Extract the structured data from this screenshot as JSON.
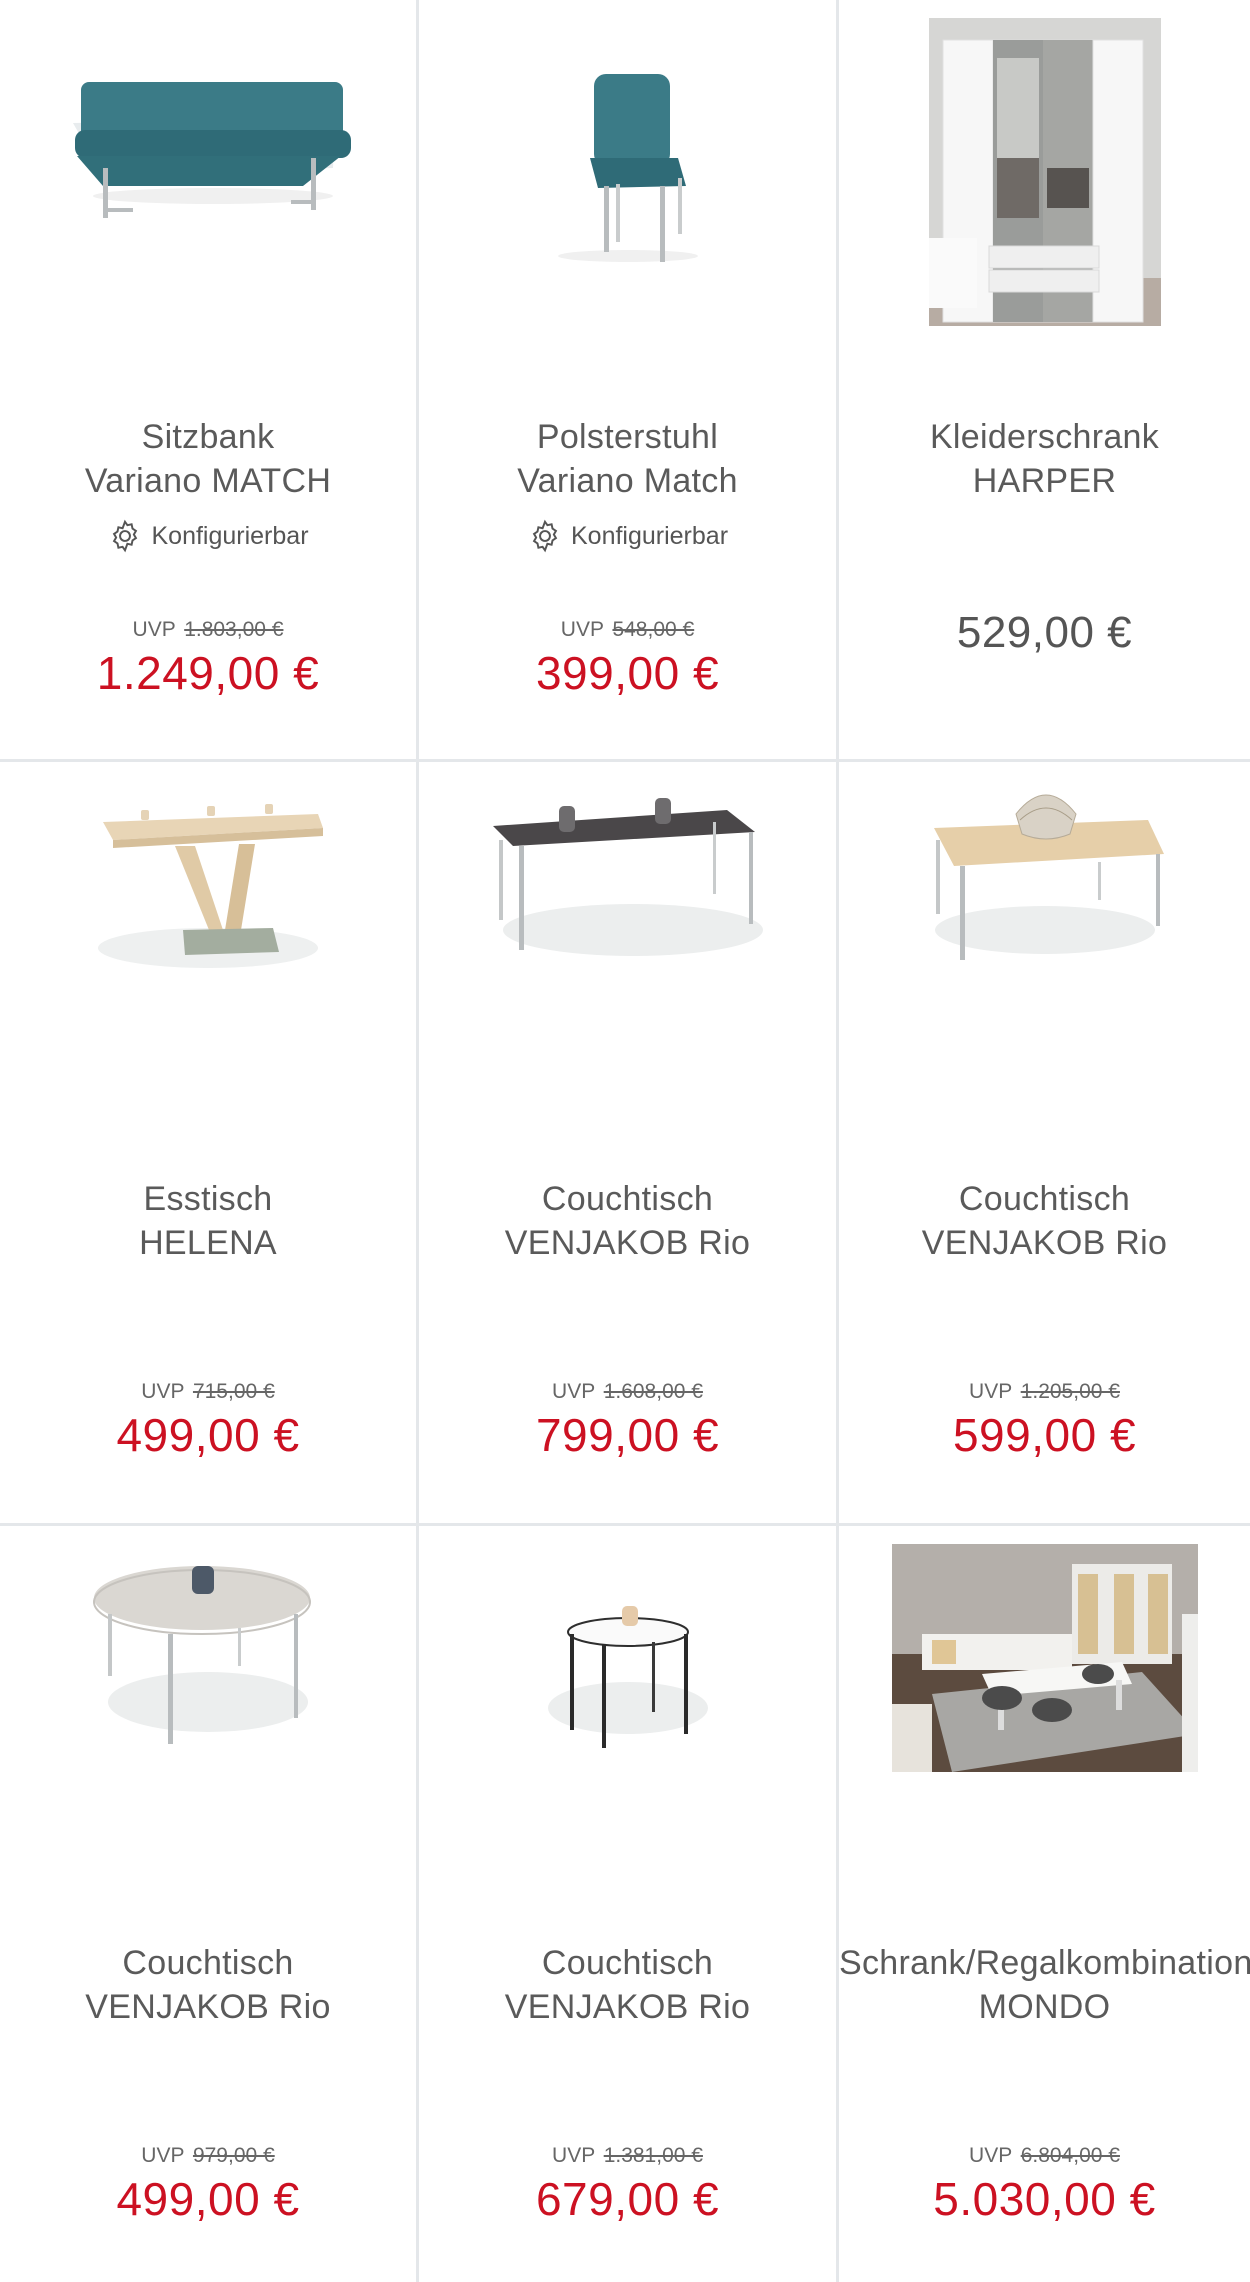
{
  "products": [
    {
      "title_line1": "Sitzbank",
      "title_line2": "Variano MATCH",
      "configurable": "Konfigurierbar",
      "uvp_label": "UVP",
      "uvp_price": "1.803,00 €",
      "price": "1.249,00 €",
      "image_icon": "bench-image"
    },
    {
      "title_line1": "Polsterstuhl",
      "title_line2": "Variano Match",
      "configurable": "Konfigurierbar",
      "uvp_label": "UVP",
      "uvp_price": "548,00 €",
      "price": "399,00 €",
      "image_icon": "chair-image"
    },
    {
      "title_line1": "Kleiderschrank",
      "title_line2": "HARPER",
      "price": "529,00 €",
      "image_icon": "wardrobe-image"
    },
    {
      "title_line1": "Esstisch",
      "title_line2": "HELENA",
      "uvp_label": "UVP",
      "uvp_price": "715,00 €",
      "price": "499,00 €",
      "image_icon": "dining-table-image"
    },
    {
      "title_line1": "Couchtisch",
      "title_line2": "VENJAKOB Rio",
      "uvp_label": "UVP",
      "uvp_price": "1.608,00 €",
      "price": "799,00 €",
      "image_icon": "dark-coffee-table-image"
    },
    {
      "title_line1": "Couchtisch",
      "title_line2": "VENJAKOB Rio",
      "uvp_label": "UVP",
      "uvp_price": "1.205,00 €",
      "price": "599,00 €",
      "image_icon": "oak-coffee-table-image"
    },
    {
      "title_line1": "Couchtisch",
      "title_line2": "VENJAKOB Rio",
      "uvp_label": "UVP",
      "uvp_price": "979,00 €",
      "price": "499,00 €",
      "image_icon": "round-coffee-table-image"
    },
    {
      "title_line1": "Couchtisch",
      "title_line2": "VENJAKOB Rio",
      "uvp_label": "UVP",
      "uvp_price": "1.381,00 €",
      "price": "679,00 €",
      "image_icon": "side-table-image"
    },
    {
      "title_line1": "Schrank/Regalkombination",
      "title_line2": "MONDO",
      "uvp_label": "UVP",
      "uvp_price": "6.804,00 €",
      "price": "5.030,00 €",
      "image_icon": "room-scene-image"
    }
  ],
  "colors": {
    "sale_price": "#cc1122",
    "text": "#555555",
    "divider": "#e4e7ea"
  }
}
